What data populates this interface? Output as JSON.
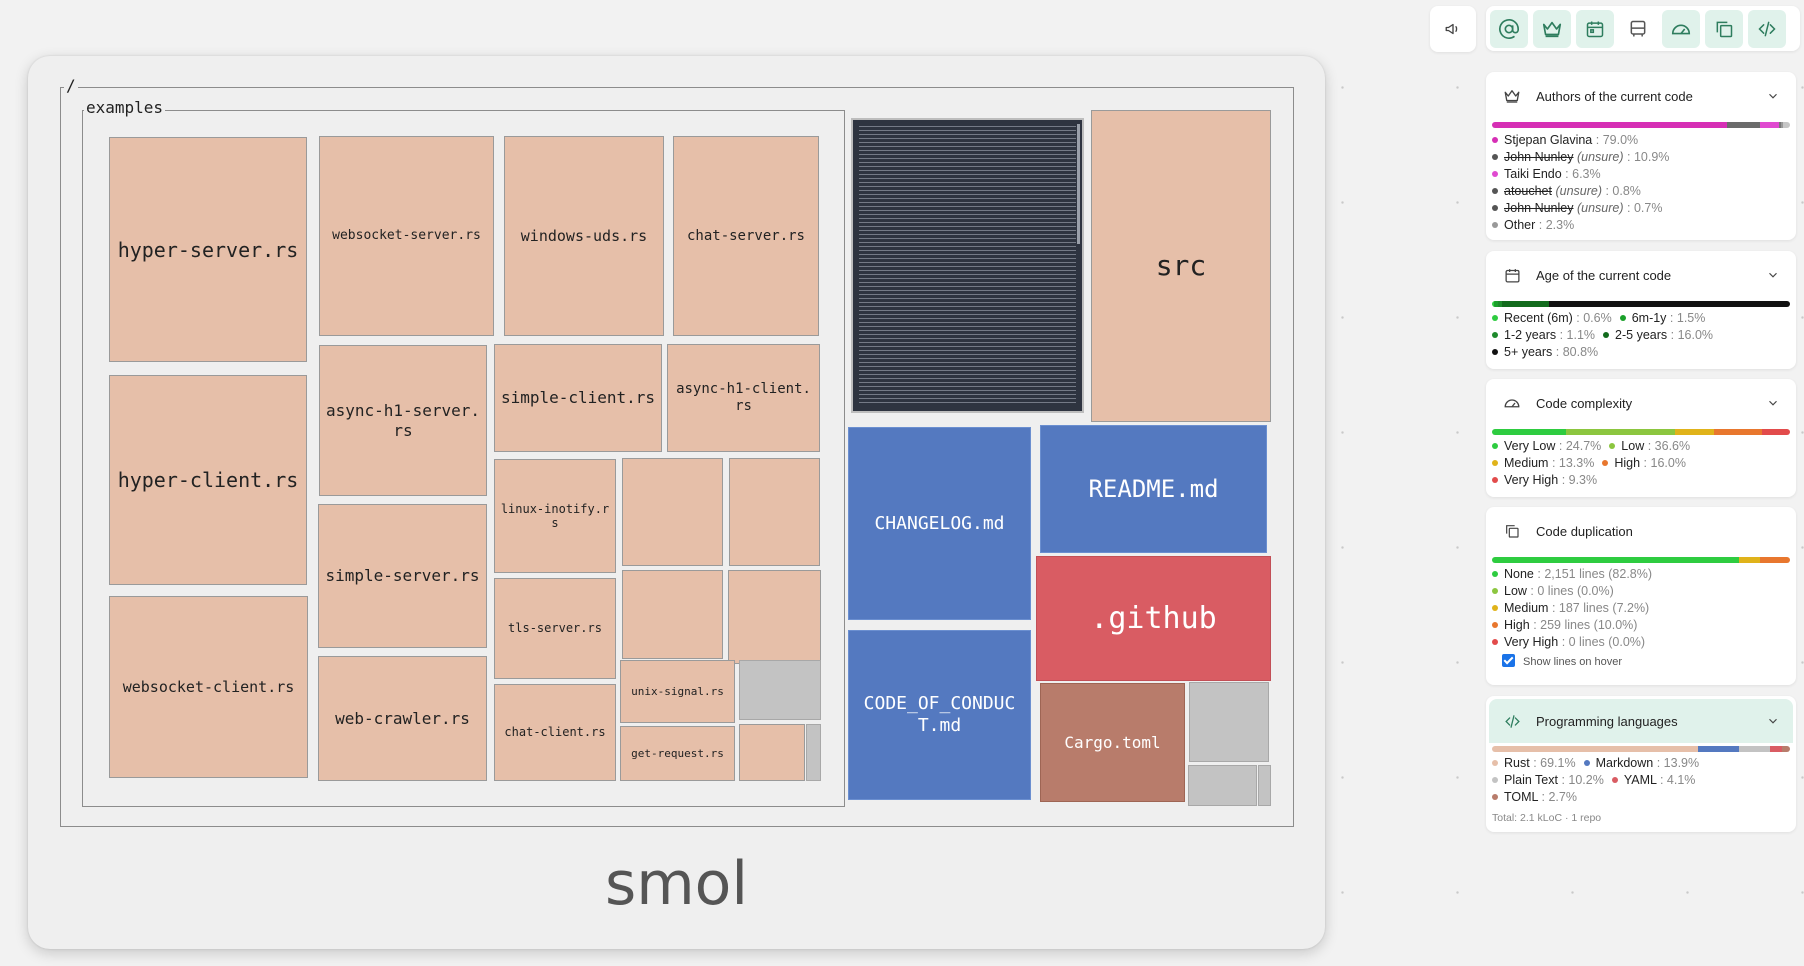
{
  "treemap": {
    "root_label": "/",
    "folder_label": "examples",
    "repo_name": "smol",
    "examples_files": [
      "hyper-server.rs",
      "hyper-client.rs",
      "websocket-client.rs",
      "websocket-server.rs",
      "windows-uds.rs",
      "chat-server.rs",
      "async-h1-server.rs",
      "simple-client.rs",
      "async-h1-client.rs",
      "simple-server.rs",
      "linux-inotify.rs",
      "tls-server.rs",
      "web-crawler.rs",
      "chat-client.rs",
      "unix-signal.rs",
      "get-request.rs"
    ],
    "root_items": [
      "src",
      "CHANGELOG.md",
      "README.md",
      ".github",
      "CODE_OF_CONDUCT.md",
      "Cargo.toml"
    ]
  },
  "toolbar": {
    "items": [
      "announce-icon",
      "at-icon",
      "crown-icon",
      "calendar-icon",
      "bus-icon",
      "gauge-icon",
      "copy-icon",
      "code-icon"
    ]
  },
  "panels": {
    "authors": {
      "title": "Authors of the current code",
      "entries": [
        {
          "name": "Stjepan Glavina",
          "value": ": 79.0%",
          "color": "#d62fb5",
          "struck": false,
          "unsure": ""
        },
        {
          "name": "John Nunley",
          "value": ": 10.9%",
          "color": "#666666",
          "struck": true,
          "unsure": "(unsure)"
        },
        {
          "name": "Taiki Endo",
          "value": ": 6.3%",
          "color": "#e04ad0",
          "struck": false,
          "unsure": ""
        },
        {
          "name": "atouchet",
          "value": ": 0.8%",
          "color": "#666666",
          "struck": true,
          "unsure": "(unsure)"
        },
        {
          "name": "John Nunley",
          "value": ": 0.7%",
          "color": "#666666",
          "struck": true,
          "unsure": "(unsure)"
        },
        {
          "name": "Other",
          "value": ": 2.3%",
          "color": "#aaaaaa",
          "struck": false,
          "unsure": ""
        }
      ]
    },
    "age": {
      "title": "Age of the current code",
      "recent": {
        "label": "Recent (6m)",
        "value": ": 0.6%"
      },
      "m6_1y": {
        "label": "6m-1y",
        "value": ": 1.5%"
      },
      "y1_2": {
        "label": "1-2 years",
        "value": ": 1.1%"
      },
      "y2_5": {
        "label": "2-5 years",
        "value": ": 16.0%"
      },
      "y5": {
        "label": "5+ years",
        "value": ": 80.8%"
      }
    },
    "complexity": {
      "title": "Code complexity",
      "very_low": {
        "label": "Very Low",
        "value": ": 24.7%"
      },
      "low": {
        "label": "Low",
        "value": ": 36.6%"
      },
      "medium": {
        "label": "Medium",
        "value": ": 13.3%"
      },
      "high": {
        "label": "High",
        "value": ": 16.0%"
      },
      "very_high": {
        "label": "Very High",
        "value": ": 9.3%"
      }
    },
    "duplication": {
      "title": "Code duplication",
      "none": {
        "label": "None",
        "value": ": 2,151 lines (82.8%)"
      },
      "low": {
        "label": "Low",
        "value": ": 0 lines (0.0%)"
      },
      "medium": {
        "label": "Medium",
        "value": ": 187 lines (7.2%)"
      },
      "high": {
        "label": "High",
        "value": ": 259 lines (10.0%)"
      },
      "very_high": {
        "label": "Very High",
        "value": ": 0 lines (0.0%)"
      },
      "show_lines_label": "Show lines on hover",
      "show_lines_checked": true
    },
    "languages": {
      "title": "Programming languages",
      "rust": {
        "label": "Rust",
        "value": ": 69.1%"
      },
      "markdown": {
        "label": "Markdown",
        "value": ": 13.9%"
      },
      "plain": {
        "label": "Plain Text",
        "value": ": 10.2%"
      },
      "yaml": {
        "label": "YAML",
        "value": ": 4.1%"
      },
      "toml": {
        "label": "TOML",
        "value": ": 2.7%"
      },
      "total": "Total: 2.1 kLoC · 1 repo"
    }
  }
}
